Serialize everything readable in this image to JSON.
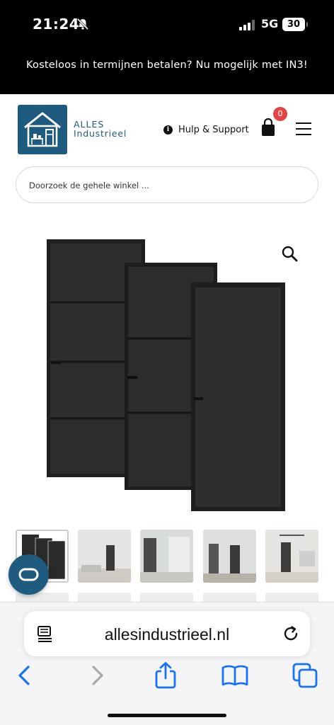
{
  "status_bar": {
    "time": "21:24",
    "network": "5G",
    "battery": "30",
    "icons": [
      "bell-muted-icon",
      "signal-icon"
    ]
  },
  "promo": {
    "text": "Kosteloos in termijnen betalen? Nu mogelijk met IN3!"
  },
  "header": {
    "logo_line1": "ALLES",
    "logo_line2": "Industrieel",
    "help_label": "Hulp & Support",
    "cart_count": "0",
    "brand_color": "#1f5b7e",
    "badge_color": "#e04646"
  },
  "search": {
    "placeholder": "Doorzoek de gehele winkel ..."
  },
  "product": {
    "image": "three-black-steel-doors",
    "thumbnail_count": 5
  },
  "browser": {
    "url": "allesindustrieel.nl",
    "accent_color": "#1a73e8"
  }
}
